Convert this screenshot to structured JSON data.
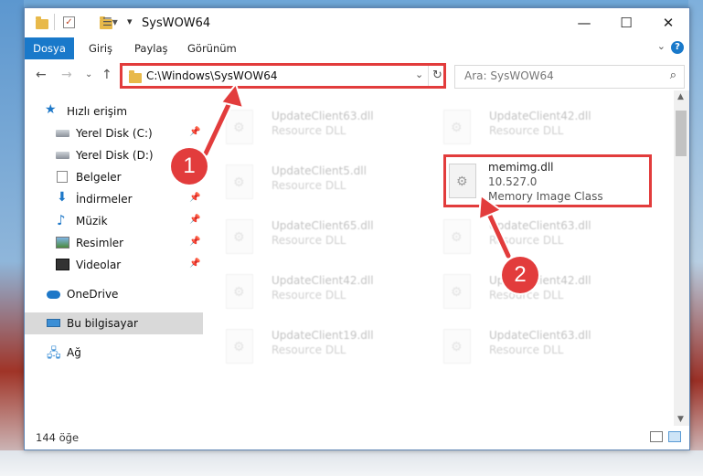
{
  "window": {
    "title": "SysWOW64"
  },
  "ribbon": {
    "tabs": [
      "Dosya",
      "Giriş",
      "Paylaş",
      "Görünüm"
    ],
    "help": "?"
  },
  "nav": {
    "path": "C:\\Windows\\SysWOW64",
    "search_placeholder": "Ara: SysWOW64"
  },
  "sidebar": {
    "items": [
      {
        "label": "Hızlı erişim",
        "icon": "star-icon"
      },
      {
        "label": "Yerel Disk (C:)",
        "icon": "drive-icon"
      },
      {
        "label": "Yerel Disk (D:)",
        "icon": "drive-icon"
      },
      {
        "label": "Belgeler",
        "icon": "documents-icon"
      },
      {
        "label": "İndirmeler",
        "icon": "download-icon"
      },
      {
        "label": "Müzik",
        "icon": "music-icon"
      },
      {
        "label": "Resimler",
        "icon": "pictures-icon"
      },
      {
        "label": "Videolar",
        "icon": "videos-icon"
      },
      {
        "label": "OneDrive",
        "icon": "cloud-icon"
      },
      {
        "label": "Bu bilgisayar",
        "icon": "computer-icon"
      },
      {
        "label": "Ağ",
        "icon": "network-icon"
      }
    ]
  },
  "files": [
    {
      "name": "UpdateClient63.dll",
      "desc": "Resource DLL"
    },
    {
      "name": "UpdateClient42.dll",
      "desc": "Resource DLL"
    },
    {
      "name": "UpdateClient5.dll",
      "desc": "Resource DLL"
    },
    {
      "name": "UpdateClient65.dll",
      "desc": "Resource DLL"
    },
    {
      "name": "UpdateClient63.dll",
      "desc": "Resource DLL"
    },
    {
      "name": "UpdateClient42.dll",
      "desc": "Resource DLL"
    },
    {
      "name": "UpdateClient42.dll",
      "desc": "Resource DLL"
    },
    {
      "name": "UpdateClient19.dll",
      "desc": "Resource DLL"
    },
    {
      "name": "UpdateClient63.dll",
      "desc": "Resource DLL"
    }
  ],
  "selected_file": {
    "name": "memimg.dll",
    "version": "10.527.0",
    "desc": "Memory Image Class"
  },
  "status": {
    "count": "144 öğe"
  },
  "callouts": [
    "1",
    "2"
  ],
  "colors": {
    "accent": "#1979ca",
    "highlight": "#e23c3c"
  }
}
